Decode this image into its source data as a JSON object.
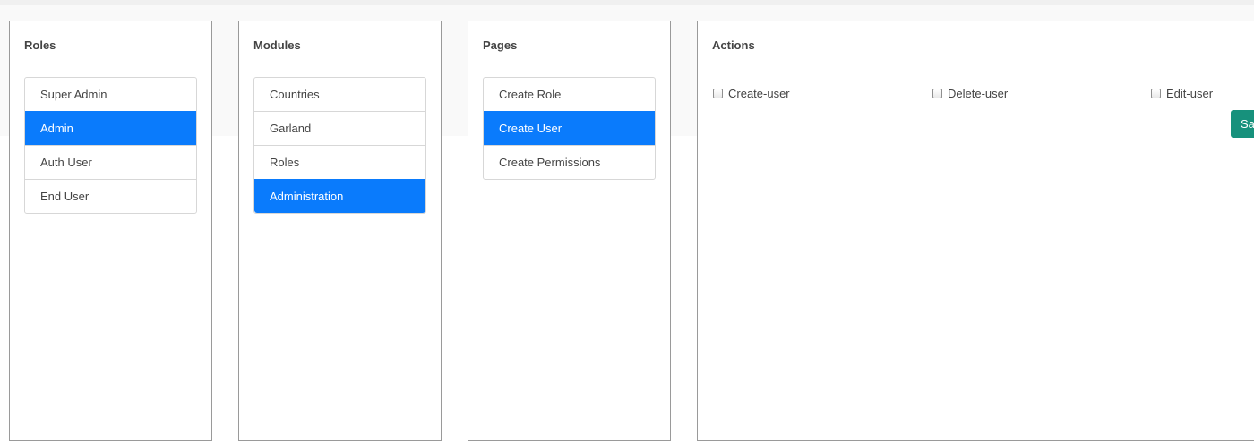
{
  "roles": {
    "title": "Roles",
    "items": [
      {
        "label": "Super Admin",
        "active": false
      },
      {
        "label": "Admin",
        "active": true
      },
      {
        "label": "Auth User",
        "active": false
      },
      {
        "label": "End User",
        "active": false
      }
    ]
  },
  "modules": {
    "title": "Modules",
    "items": [
      {
        "label": "Countries",
        "active": false
      },
      {
        "label": "Garland",
        "active": false
      },
      {
        "label": "Roles",
        "active": false
      },
      {
        "label": "Administration",
        "active": true
      }
    ]
  },
  "pages": {
    "title": "Pages",
    "items": [
      {
        "label": "Create Role",
        "active": false
      },
      {
        "label": "Create User",
        "active": true
      },
      {
        "label": "Create Permissions",
        "active": false
      }
    ]
  },
  "actions": {
    "title": "Actions",
    "checkboxes": [
      {
        "label": "Create-user",
        "checked": false
      },
      {
        "label": "Delete-user",
        "checked": false
      },
      {
        "label": "Edit-user",
        "checked": false
      }
    ],
    "save_label": "Sa"
  },
  "colors": {
    "active_item": "#0a7bfc",
    "save_button": "#17917c"
  }
}
